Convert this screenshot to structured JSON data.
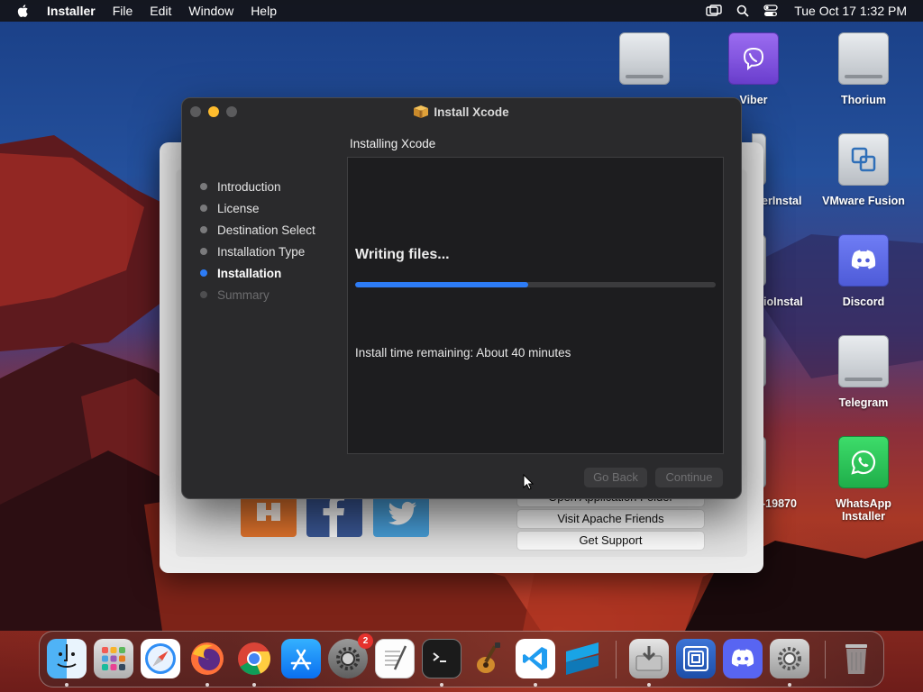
{
  "menubar": {
    "app_name": "Installer",
    "menus": [
      "File",
      "Edit",
      "Window",
      "Help"
    ],
    "clock": "Tue Oct 17  1:32 PM",
    "status_icons": [
      "screen-mirroring-icon",
      "search-icon",
      "control-center-icon"
    ]
  },
  "desktop": {
    "icons": [
      {
        "label": "Viber",
        "icon": "viber-icon"
      },
      {
        "label": "Thorium",
        "icon": "drive-icon"
      },
      {
        "label": "VMware Fusion",
        "icon": "vmware-icon"
      },
      {
        "label": "Discord",
        "icon": "discord-icon"
      },
      {
        "label": "Telegram",
        "icon": "drive-icon"
      },
      {
        "label": "WhatsApp Installer",
        "icon": "whatsapp-icon"
      }
    ],
    "partial_labels": [
      "erInstal",
      "ioInstal",
      "-19870"
    ]
  },
  "background_window": {
    "buttons": [
      "Open Application Folder",
      "Visit Apache Friends",
      "Get Support"
    ]
  },
  "installer": {
    "title": "Install Xcode",
    "heading": "Installing Xcode",
    "steps": [
      {
        "label": "Introduction",
        "state": "done"
      },
      {
        "label": "License",
        "state": "done"
      },
      {
        "label": "Destination Select",
        "state": "done"
      },
      {
        "label": "Installation Type",
        "state": "done"
      },
      {
        "label": "Installation",
        "state": "active"
      },
      {
        "label": "Summary",
        "state": "disabled"
      }
    ],
    "status": "Writing files...",
    "progress": 0.48,
    "time_remaining": "Install time remaining: About 40 minutes",
    "go_back_label": "Go Back",
    "continue_label": "Continue",
    "accent_color": "#2d7cf6"
  },
  "dock": {
    "apps": [
      "finder-icon",
      "launchpad-icon",
      "safari-icon",
      "firefox-icon",
      "chrome-icon",
      "app-store-icon",
      "system-settings-icon",
      "textedit-icon",
      "terminal-icon",
      "garageband-icon",
      "vscode-icon",
      "sublime-icon",
      "installer-icon",
      "preview-icon",
      "discord-icon",
      "system-preferences-icon",
      "trash-icon"
    ],
    "system_settings_badge": "2"
  }
}
